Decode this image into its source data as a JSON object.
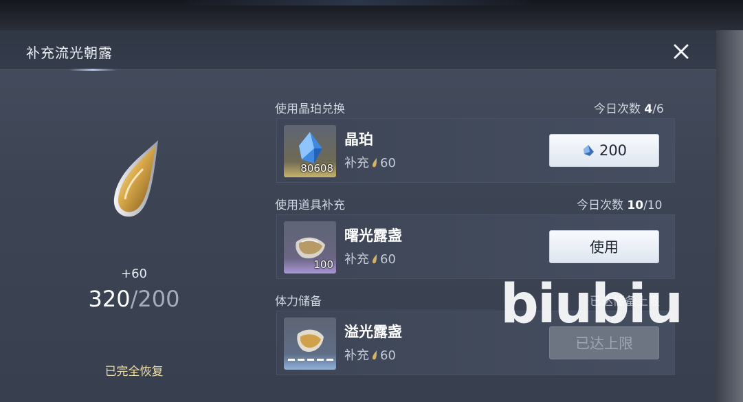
{
  "dialog": {
    "title": "补充流光朝露",
    "close_icon": "close-icon"
  },
  "left": {
    "gain": "+60",
    "current": "320",
    "separator_max": "/200",
    "status": "已完全恢复"
  },
  "sections": {
    "exchange": {
      "label": "使用晶珀兑换",
      "daily_label": "今日次数 ",
      "daily_used": "4",
      "daily_total": "/6",
      "item": {
        "name": "晶珀",
        "qty": "80608",
        "sub_label": "补充",
        "sub_value": "60",
        "button_value": "200",
        "button_icon": "crystal-icon"
      }
    },
    "item_use": {
      "label": "使用道具补充",
      "daily_label": "今日次数 ",
      "daily_used": "10",
      "daily_total": "/10",
      "item": {
        "name": "曙光露盏",
        "qty": "100",
        "sub_label": "补充",
        "sub_value": "60",
        "button_label": "使用"
      }
    },
    "reserve": {
      "label": "体力储备",
      "status": "已达储备上限",
      "item": {
        "name": "溢光露盏",
        "sub_label": "补充",
        "sub_value": "60",
        "button_label": "已达上限"
      }
    }
  },
  "watermark": "biubiu",
  "colors": {
    "panel": "#3d4555",
    "gold": "#f0dfa8",
    "button": "#eef2f8",
    "button_disabled": "#6d7482"
  }
}
